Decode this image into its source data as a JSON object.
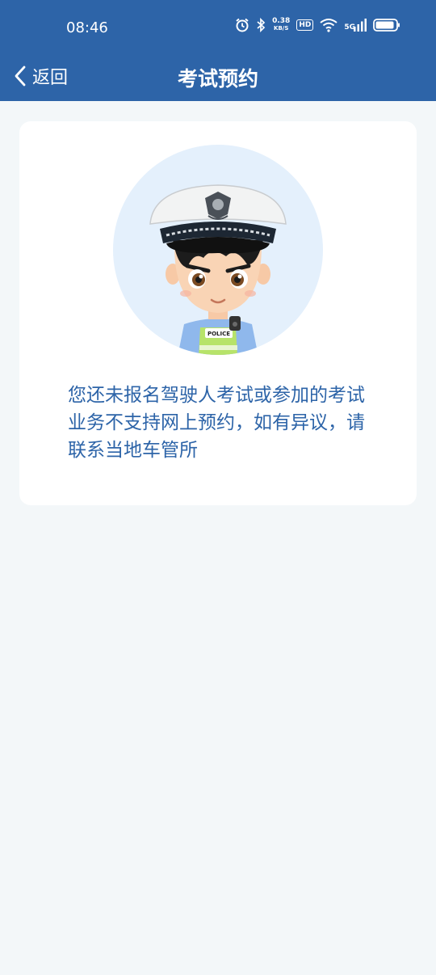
{
  "status_bar": {
    "time": "08:46",
    "net_speed_value": "0.38",
    "net_speed_unit": "KB/S",
    "hd_label": "HD",
    "signal_label": "5G"
  },
  "nav": {
    "back_label": "返回",
    "title": "考试预约"
  },
  "illustration": {
    "badge_text": "POLICE"
  },
  "message": "您还未报名驾驶人考试或参加的考试业务不支持网上预约，如有异议，请联系当地车管所",
  "colors": {
    "header": "#2d64a8",
    "background": "#f3f7f9",
    "text_accent": "#2d64a8",
    "circle": "#e4f0fc"
  }
}
